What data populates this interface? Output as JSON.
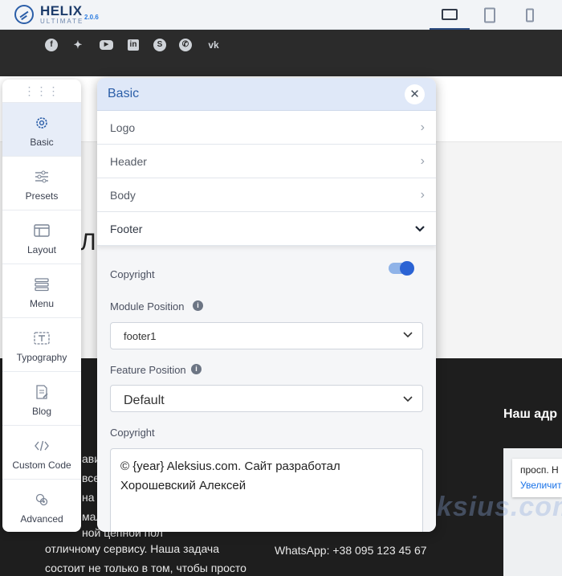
{
  "app": {
    "name": "HELIX",
    "subtitle": "ULTIMATE",
    "version": "2.0.6"
  },
  "devices": [
    {
      "name": "desktop",
      "active": true
    },
    {
      "name": "tablet",
      "active": false
    },
    {
      "name": "mobile",
      "active": false
    }
  ],
  "social_icons": [
    "facebook-icon",
    "twitter-icon",
    "youtube-icon",
    "linkedin-icon",
    "skype-icon",
    "whatsapp-icon",
    "vk-icon"
  ],
  "sidebar": {
    "items": [
      {
        "label": "Basic",
        "icon": "gear-icon",
        "active": true
      },
      {
        "label": "Presets",
        "icon": "sliders-icon",
        "active": false
      },
      {
        "label": "Layout",
        "icon": "layout-icon",
        "active": false
      },
      {
        "label": "Menu",
        "icon": "menu-icon",
        "active": false
      },
      {
        "label": "Typography",
        "icon": "typography-icon",
        "active": false
      },
      {
        "label": "Blog",
        "icon": "blog-icon",
        "active": false
      },
      {
        "label": "Custom Code",
        "icon": "code-icon",
        "active": false
      },
      {
        "label": "Advanced",
        "icon": "advanced-icon",
        "active": false
      }
    ]
  },
  "panel": {
    "title": "Basic",
    "sections": [
      {
        "label": "Logo",
        "expanded": false
      },
      {
        "label": "Header",
        "expanded": false
      },
      {
        "label": "Body",
        "expanded": false
      },
      {
        "label": "Footer",
        "expanded": true
      }
    ],
    "footer": {
      "copyright_toggle_label": "Copyright",
      "copyright_enabled": true,
      "module_position_label": "Module Position",
      "module_position_value": "footer1",
      "feature_position_label": "Feature Position",
      "feature_position_value": "Default",
      "copyright_text_label": "Copyright",
      "copyright_text_line1": "© {year} Aleksius.com. Сайт разработал",
      "copyright_text_line2": "Хорошевский Алексей"
    }
  },
  "site": {
    "heading_fragment": "Л",
    "footer_col1": [
      "ави",
      "все",
      "на",
      "мальн",
      "ной цепной пол",
      "отличному сервису. Наша задача",
      "состоит не только в том, чтобы просто"
    ],
    "footer_col1_mark": ":",
    "footer_whatsapp": "WhatsApp: +38 095 123 45 67",
    "footer_address_title": "Наш адр",
    "map_card_title": "просп. Н",
    "map_card_link": "Увеличит",
    "watermark": "Aleksius.com"
  },
  "colors": {
    "accent": "#2b5ea8",
    "panel_header": "#dfe8f8",
    "toggle_on": "#2b63d4",
    "footer_bg": "#1e1e1e"
  }
}
